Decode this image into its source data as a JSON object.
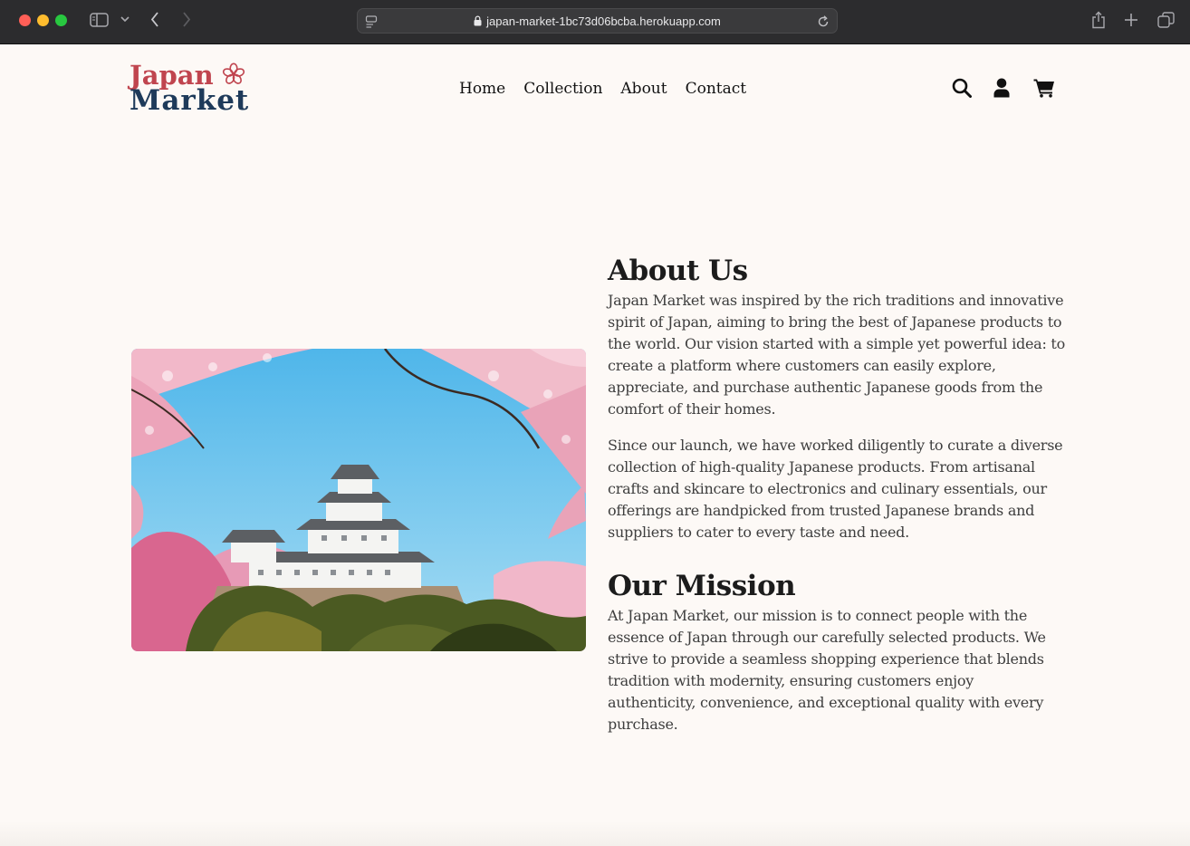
{
  "browser": {
    "url": "japan-market-1bc73d06bcba.herokuapp.com"
  },
  "site": {
    "logo": {
      "line1": "Japan",
      "line2": "Market"
    },
    "nav": [
      "Home",
      "Collection",
      "About",
      "Contact"
    ],
    "icons": [
      "search-icon",
      "user-icon",
      "cart-icon"
    ]
  },
  "about": {
    "title": "About Us",
    "paragraphs": [
      "Japan Market was inspired by the rich traditions and innovative spirit of Japan, aiming to bring the best of Japanese products to the world. Our vision started with a simple yet powerful idea: to create a platform where customers can easily explore, appreciate, and purchase authentic Japanese goods from the comfort of their homes.",
      "Since our launch, we have worked diligently to curate a diverse collection of high-quality Japanese products. From artisanal crafts and skincare to electronics and culinary essentials, our offerings are handpicked from trusted Japanese brands and suppliers to cater to every taste and need."
    ]
  },
  "mission": {
    "title": "Our Mission",
    "paragraph": "At Japan Market, our mission is to connect people with the essence of Japan through our carefully selected products. We strive to provide a seamless shopping experience that blends tradition with modernity, ensuring customers enjoy authenticity, convenience, and exceptional quality with every purchase."
  },
  "colors": {
    "brand_red": "#c0454f",
    "brand_navy": "#1e3a5a",
    "page_bg": "#fdf9f6"
  }
}
